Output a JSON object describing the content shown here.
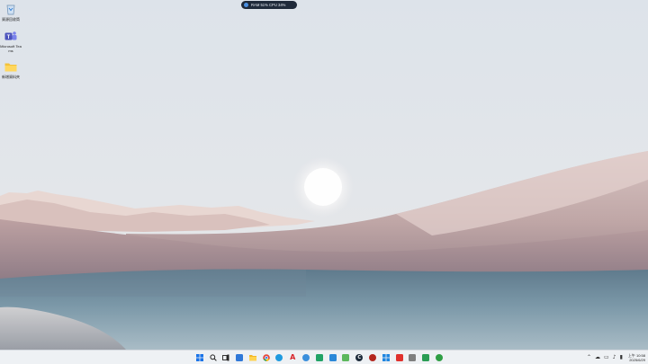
{
  "desktop": {
    "icons": [
      {
        "label": "資源回收筒",
        "icon": "recycle-bin-icon"
      },
      {
        "label": "Microsoft Teams",
        "icon": "teams-icon"
      },
      {
        "label": "新增資料夾",
        "icon": "folder-icon"
      }
    ]
  },
  "resource_monitor": {
    "text": "RAM 51%   CPU 34%"
  },
  "taskbar": {
    "apps": [
      {
        "icon": "windows-start-icon",
        "glyph": "",
        "color": "#1a73e8"
      },
      {
        "icon": "search-icon",
        "glyph": "",
        "color": "#222222"
      },
      {
        "icon": "task-view-icon",
        "glyph": "",
        "color": "#222222"
      },
      {
        "icon": "widgets-icon",
        "glyph": "",
        "color": "#2f78d8"
      },
      {
        "icon": "file-explorer-icon",
        "glyph": "",
        "color": "#f2b827"
      },
      {
        "icon": "chrome-icon",
        "glyph": "",
        "color": "#e4473a"
      },
      {
        "icon": "edge-icon",
        "glyph": "",
        "color": "#1e9adf"
      },
      {
        "icon": "acrobat-icon",
        "glyph": "A",
        "color": "#d8242a"
      },
      {
        "icon": "app-icon-blue-globe",
        "glyph": "",
        "color": "#3a8fdc"
      },
      {
        "icon": "app-icon-green",
        "glyph": "",
        "color": "#21a366"
      },
      {
        "icon": "app-icon-blue-chat",
        "glyph": "",
        "color": "#2b88d8"
      },
      {
        "icon": "app-icon-green-robot",
        "glyph": "",
        "color": "#5cb85c"
      },
      {
        "icon": "app-icon-dark-circle",
        "glyph": "C",
        "color": "#1d2b3a"
      },
      {
        "icon": "app-icon-red-circle",
        "glyph": "",
        "color": "#b3261e"
      },
      {
        "icon": "app-icon-windows-grid",
        "glyph": "",
        "color": "#1f86e0"
      },
      {
        "icon": "pdf-icon",
        "glyph": "",
        "color": "#e0312d"
      },
      {
        "icon": "app-icon-clock",
        "glyph": "",
        "color": "#7f7f7f"
      },
      {
        "icon": "app-icon-green-box",
        "glyph": "",
        "color": "#2a9d54"
      },
      {
        "icon": "app-icon-globe-green",
        "glyph": "",
        "color": "#2f9e44"
      }
    ]
  },
  "tray": {
    "icons": [
      "chevron-up-icon",
      "cloud-icon",
      "network-icon",
      "speaker-icon",
      "battery-icon"
    ],
    "time": "上午 10:58",
    "date": "2025/6/29"
  }
}
